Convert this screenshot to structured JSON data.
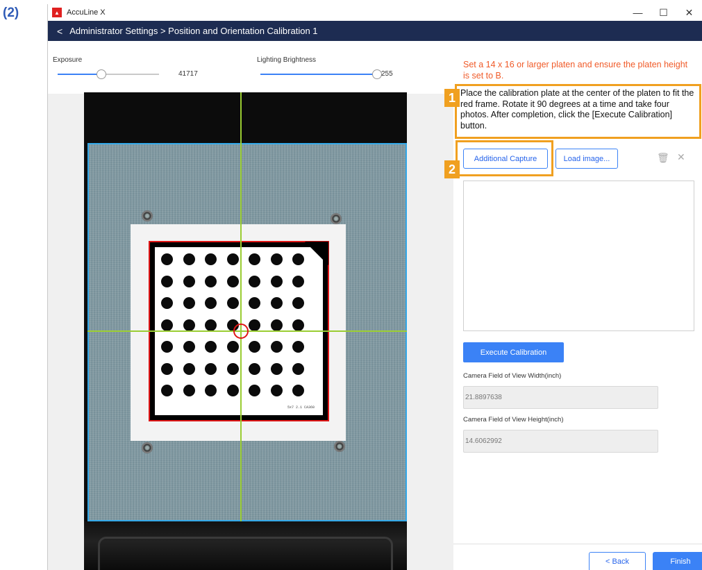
{
  "figure_label": "(2)",
  "window": {
    "title": "AccuLine X",
    "controls": {
      "minimize": "—",
      "maximize": "☐",
      "close": "✕"
    }
  },
  "header": {
    "back_glyph": "<",
    "breadcrumb": "Administrator Settings > Position and Orientation Calibration 1"
  },
  "left_controls": {
    "exposure_label": "Exposure",
    "exposure_value": "41717",
    "exposure_fraction": 0.43,
    "brightness_label": "Lighting Brightness",
    "brightness_value": "255",
    "brightness_fraction": 1.0
  },
  "camera_view": {
    "plate_text": "5x7 2.1 CA360"
  },
  "right_panel": {
    "warning": "Set a 14 x 16 or larger platen and ensure the platen height is set to B.",
    "step1_number": "1",
    "instruction": "Place the calibration plate at the center of the platen to fit the red frame. Rotate it 90 degrees at a time and take four photos. After completion, click the [Execute Calibration] button.",
    "step2_number": "2",
    "additional_capture_label": "Additional Capture",
    "load_image_label": "Load image...",
    "execute_label": "Execute Calibration",
    "fov_width_label": "Camera Field of View Width(inch)",
    "fov_width_value": "21.8897638",
    "fov_height_label": "Camera Field of View Height(inch)",
    "fov_height_value": "14.6062992",
    "back_label": "< Back",
    "finish_label": "Finish",
    "delete_icon_glyph": "🗑",
    "close_icon_glyph": "✕"
  },
  "colors": {
    "header_bg": "#1d2c52",
    "accent": "#3b82f6",
    "warning": "#f05a28",
    "callout": "#f0a020",
    "frame_red": "#e01616",
    "crosshair": "#9acd32",
    "fov_blue": "#33a8e8"
  }
}
